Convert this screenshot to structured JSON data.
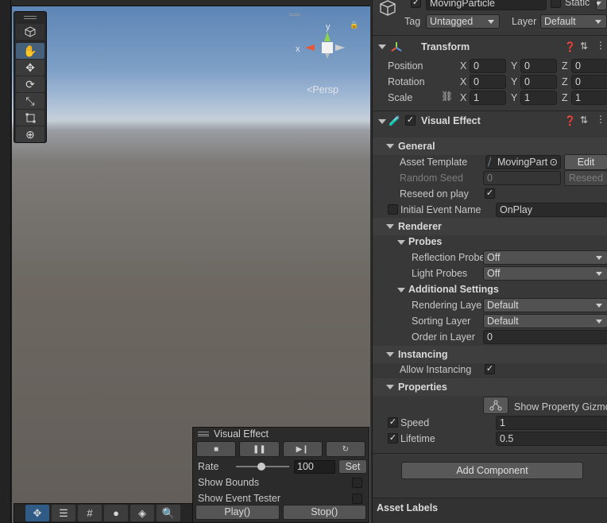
{
  "scene": {
    "gizmo": {
      "y_label": "y",
      "x_label": "x",
      "lock_icon": "lock-icon"
    },
    "persp_label": "Persp",
    "tools": [
      "view-cube-icon",
      "hand-icon",
      "move-icon",
      "rotate-icon",
      "scale-icon",
      "rect-icon",
      "transform-icon"
    ]
  },
  "vfx_overlay": {
    "title": "Visual Effect",
    "rate_label": "Rate",
    "rate_value": "100",
    "rate_fraction": 0.48,
    "set_label": "Set",
    "show_bounds": "Show Bounds",
    "show_event_tester": "Show Event Tester",
    "play_label": "Play()",
    "stop_label": "Stop()"
  },
  "inspector": {
    "object_name": "MovingParticle",
    "static_label": "Static",
    "tag_label": "Tag",
    "tag_value": "Untagged",
    "layer_label": "Layer",
    "layer_value": "Default",
    "transform": {
      "title": "Transform",
      "position_label": "Position",
      "rotation_label": "Rotation",
      "scale_label": "Scale",
      "position": {
        "x": "0",
        "y": "0",
        "z": "0"
      },
      "rotation": {
        "x": "0",
        "y": "0",
        "z": "0"
      },
      "scale": {
        "x": "1",
        "y": "1",
        "z": "1"
      },
      "axis_x": "X",
      "axis_y": "Y",
      "axis_z": "Z"
    },
    "visual_effect": {
      "title": "Visual Effect",
      "general_title": "General",
      "asset_template_label": "Asset Template",
      "asset_template_value": "MovingPart",
      "edit_label": "Edit",
      "random_seed_label": "Random Seed",
      "random_seed_value": "0",
      "reseed_label": "Reseed",
      "reseed_on_play_label": "Reseed on play",
      "initial_event_label": "Initial Event Name",
      "initial_event_value": "OnPlay",
      "renderer_title": "Renderer",
      "probes_title": "Probes",
      "reflection_probes_label": "Reflection Probe",
      "reflection_probes_value": "Off",
      "light_probes_label": "Light Probes",
      "light_probes_value": "Off",
      "additional_title": "Additional Settings",
      "rendering_layer_label": "Rendering Laye",
      "rendering_layer_value": "Default",
      "sorting_layer_label": "Sorting Layer",
      "sorting_layer_value": "Default",
      "order_in_layer_label": "Order in Layer",
      "order_in_layer_value": "0",
      "instancing_title": "Instancing",
      "allow_instancing_label": "Allow Instancing",
      "properties_title": "Properties",
      "show_gizmo_label": "Show Property Gizmo",
      "speed_label": "Speed",
      "speed_value": "1",
      "lifetime_label": "Lifetime",
      "lifetime_value": "0.5"
    },
    "add_component_label": "Add Component",
    "asset_labels": "Asset Labels"
  }
}
